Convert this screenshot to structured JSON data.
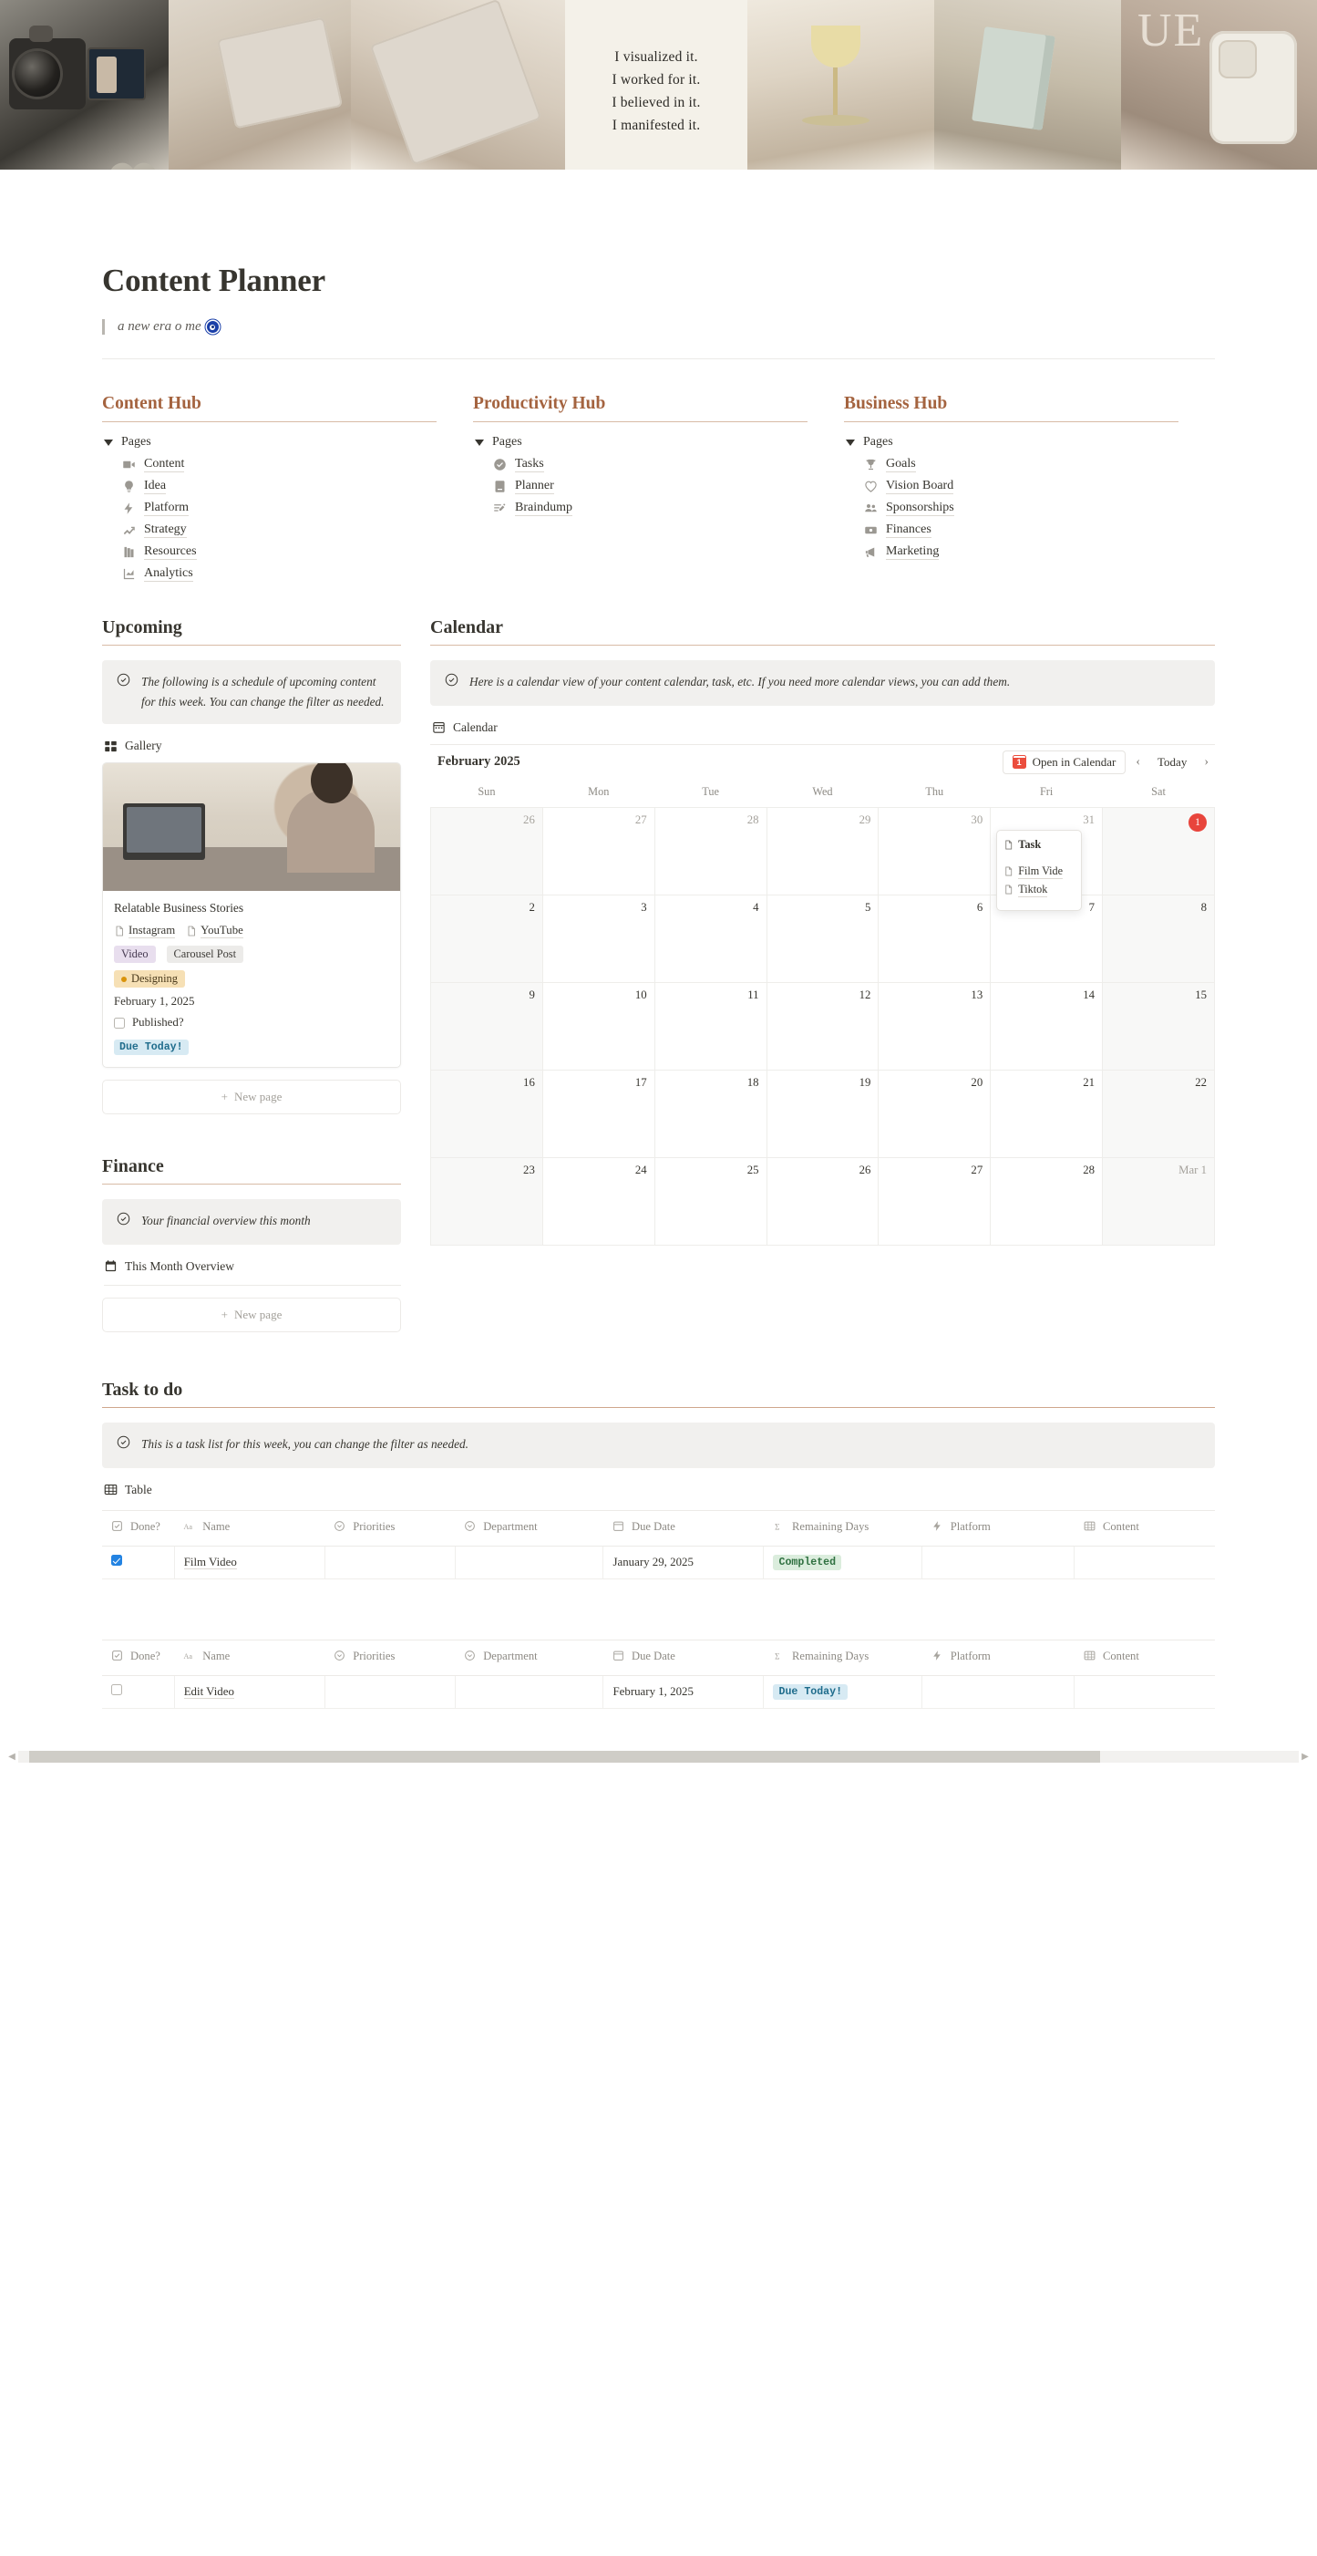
{
  "cover": {
    "quote_lines": [
      "I visualized it.",
      "I worked for it.",
      "I believed in it.",
      "I manifested it."
    ],
    "heart_icon": "heart-icon"
  },
  "page": {
    "title": "Content Planner",
    "subtitle": "a new era o me",
    "subtitle_emoji": "nazar-amulet-icon"
  },
  "hubs": [
    {
      "title": "Content Hub",
      "toggle_label": "Pages",
      "items": [
        {
          "label": "Content",
          "icon": "video-camera-icon"
        },
        {
          "label": "Idea",
          "icon": "lightbulb-icon"
        },
        {
          "label": "Platform",
          "icon": "lightning-bolt-icon"
        },
        {
          "label": "Strategy",
          "icon": "trending-up-icon"
        },
        {
          "label": "Resources",
          "icon": "books-icon"
        },
        {
          "label": "Analytics",
          "icon": "bar-chart-icon"
        }
      ]
    },
    {
      "title": "Productivity Hub",
      "toggle_label": "Pages",
      "items": [
        {
          "label": "Tasks",
          "icon": "check-circle-icon"
        },
        {
          "label": "Planner",
          "icon": "notebook-icon"
        },
        {
          "label": "Braindump",
          "icon": "pencil-list-icon"
        }
      ]
    },
    {
      "title": "Business Hub",
      "toggle_label": "Pages",
      "items": [
        {
          "label": "Goals",
          "icon": "trophy-icon"
        },
        {
          "label": "Vision Board",
          "icon": "heart-outline-icon"
        },
        {
          "label": "Sponsorships",
          "icon": "people-icon"
        },
        {
          "label": "Finances",
          "icon": "money-icon"
        },
        {
          "label": "Marketing",
          "icon": "megaphone-icon"
        }
      ]
    }
  ],
  "upcoming": {
    "title": "Upcoming",
    "callout": "The following is a schedule of upcoming content for this week. You can change the filter as needed.",
    "view_label": "Gallery",
    "view_icon": "gallery-grid-icon",
    "card": {
      "name": "Relatable Business Stories",
      "relations": [
        {
          "label": "Instagram",
          "icon": "page-icon"
        },
        {
          "label": "YouTube",
          "icon": "page-icon"
        }
      ],
      "tags": [
        {
          "label": "Video",
          "style": "video"
        },
        {
          "label": "Carousel Post",
          "style": "carousel"
        }
      ],
      "status": {
        "label": "Designing",
        "dot_color": "#d9930a"
      },
      "date": "February 1, 2025",
      "published_label": "Published?",
      "published_checked": false,
      "remaining": "Due  Today!"
    },
    "new_page_label": "New page"
  },
  "finance": {
    "title": "Finance",
    "callout": "Your financial overview this month",
    "link_label": "This Month Overview",
    "link_icon": "calendar-filled-icon",
    "new_page_label": "New page"
  },
  "calendar": {
    "title": "Calendar",
    "callout": "Here is a calendar view of your content calendar, task, etc. If you need more calendar views, you can add them.",
    "view_label": "Calendar",
    "view_icon": "calendar-view-icon",
    "month": "February 2025",
    "open_in_calendar_label": "Open in Calendar",
    "open_in_calendar_icon": "calendar-app-icon",
    "prev_label": "‹",
    "today_label": "Today",
    "next_label": "›",
    "weekdays": [
      "Sun",
      "Mon",
      "Tue",
      "Wed",
      "Thu",
      "Fri",
      "Sat"
    ],
    "weeks": [
      [
        {
          "num": "26",
          "muted": true,
          "weekend": true
        },
        {
          "num": "27",
          "muted": true
        },
        {
          "num": "28",
          "muted": true
        },
        {
          "num": "29",
          "muted": true
        },
        {
          "num": "30",
          "muted": true
        },
        {
          "num": "31",
          "muted": true,
          "popover": true
        },
        {
          "num": "1",
          "today": true,
          "weekend": true
        }
      ],
      [
        {
          "num": "2",
          "weekend": true
        },
        {
          "num": "3"
        },
        {
          "num": "4"
        },
        {
          "num": "5"
        },
        {
          "num": "6"
        },
        {
          "num": "7"
        },
        {
          "num": "8",
          "weekend": true
        }
      ],
      [
        {
          "num": "9",
          "weekend": true
        },
        {
          "num": "10"
        },
        {
          "num": "11"
        },
        {
          "num": "12"
        },
        {
          "num": "13"
        },
        {
          "num": "14"
        },
        {
          "num": "15",
          "weekend": true
        }
      ],
      [
        {
          "num": "16",
          "weekend": true
        },
        {
          "num": "17"
        },
        {
          "num": "18"
        },
        {
          "num": "19"
        },
        {
          "num": "20"
        },
        {
          "num": "21"
        },
        {
          "num": "22",
          "weekend": true
        }
      ],
      [
        {
          "num": "23",
          "weekend": true
        },
        {
          "num": "24"
        },
        {
          "num": "25"
        },
        {
          "num": "26"
        },
        {
          "num": "27"
        },
        {
          "num": "28"
        },
        {
          "num": "Mar 1",
          "muted": true,
          "weekend": true
        }
      ]
    ],
    "popover": {
      "title": "Task",
      "title_icon": "page-icon",
      "items": [
        {
          "label": "Film Vide",
          "icon": "page-icon"
        },
        {
          "label": "Tiktok",
          "icon": "page-icon"
        }
      ]
    }
  },
  "tasks": {
    "title": "Task to do",
    "callout": "This is a task list for this week, you can change the filter as needed.",
    "view_label": "Table",
    "view_icon": "table-icon",
    "columns": [
      {
        "label": "Done?",
        "icon": "checkbox-icon"
      },
      {
        "label": "Name",
        "icon": "text-aa-icon"
      },
      {
        "label": "Priorities",
        "icon": "select-icon"
      },
      {
        "label": "Department",
        "icon": "select-icon"
      },
      {
        "label": "Due Date",
        "icon": "calendar-view-icon"
      },
      {
        "label": "Remaining Days",
        "icon": "sigma-icon"
      },
      {
        "label": "Platform",
        "icon": "lightning-bolt-icon"
      },
      {
        "label": "Content",
        "icon": "table-icon"
      }
    ],
    "tables": [
      {
        "rows": [
          {
            "done": true,
            "name": "Film Video",
            "priorities": "",
            "department": "",
            "due_date": "January 29, 2025",
            "remaining": "Completed",
            "remaining_style": "done",
            "platform": "",
            "content": ""
          }
        ]
      },
      {
        "rows": [
          {
            "done": false,
            "name": "Edit Video",
            "priorities": "",
            "department": "",
            "due_date": "February 1, 2025",
            "remaining": "Due  Today!",
            "remaining_style": "due",
            "platform": "",
            "content": ""
          }
        ]
      }
    ]
  },
  "colors": {
    "accent_heading": "#a4633f",
    "accent_rule": "#d8bba6",
    "callout_bg": "#f1f0ee",
    "today_red": "#e8453c",
    "checkbox_blue": "#2383e2",
    "badge_due_bg": "#d7eaf3",
    "badge_done_bg": "#dbeddd"
  }
}
